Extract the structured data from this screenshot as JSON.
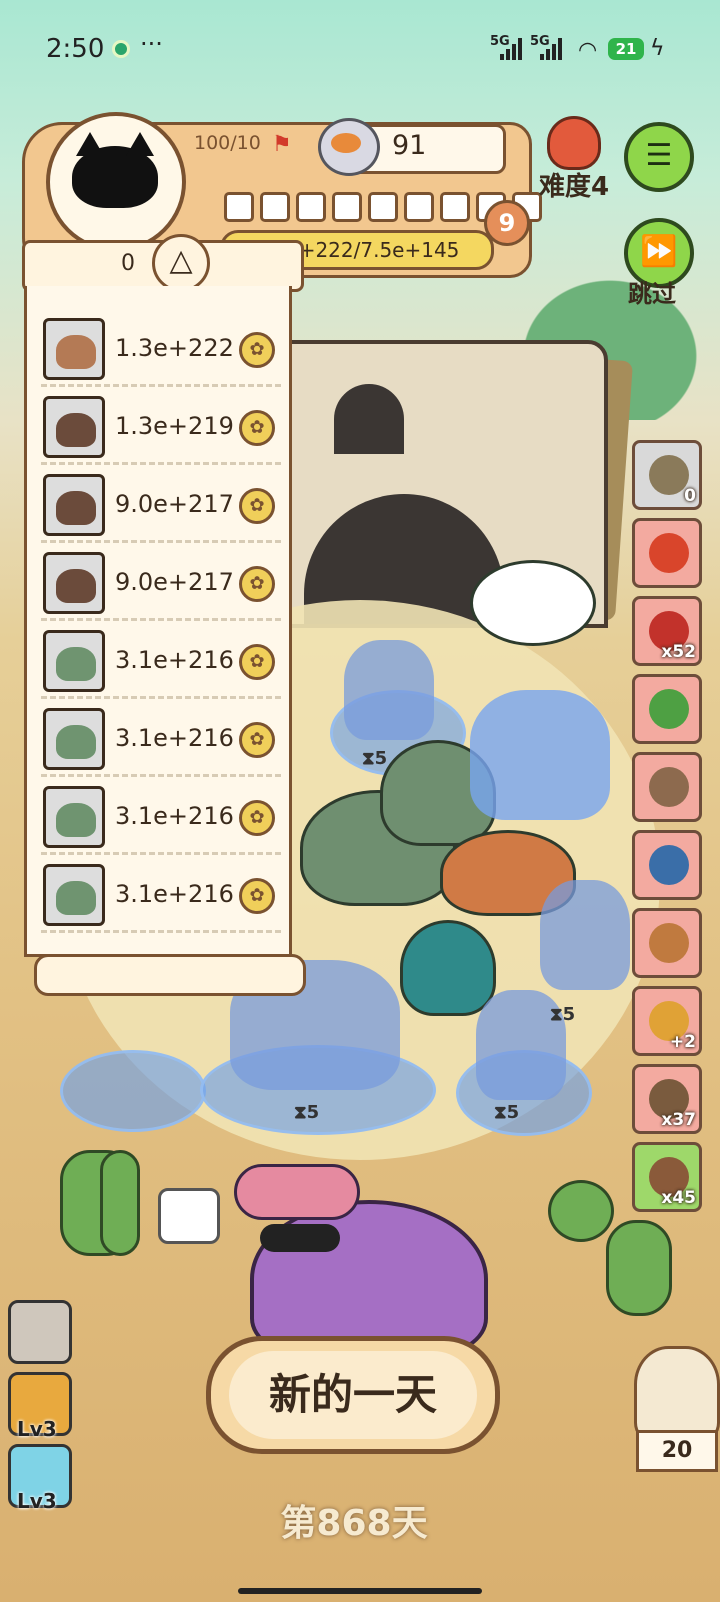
{
  "status_bar": {
    "time": "2:50",
    "more": "···",
    "net1": "5G",
    "net2": "5G",
    "battery": "21"
  },
  "player": {
    "stamina": "100/10",
    "coins": "91",
    "level": "9",
    "exp": "4.9e+222/7.5e+145",
    "level_pips": 9
  },
  "difficulty": {
    "label": "难度4"
  },
  "menu": {
    "icon": "list-icon"
  },
  "skip": {
    "label": "跳过",
    "icon": "fast-forward-icon"
  },
  "ranking": {
    "count": "0",
    "toggle_icon": "triangle-up-icon",
    "rows": [
      {
        "animal": "mammoth",
        "value": "1.3e+222",
        "color": "#b47a55"
      },
      {
        "animal": "shoebill",
        "value": "1.3e+219",
        "color": "#6b4b3b"
      },
      {
        "animal": "shoebill",
        "value": "9.0e+217",
        "color": "#6b4b3b"
      },
      {
        "animal": "shoebill",
        "value": "9.0e+217",
        "color": "#6b4b3b"
      },
      {
        "animal": "brachiosaurus",
        "value": "3.1e+216",
        "color": "#6f9470"
      },
      {
        "animal": "brachiosaurus",
        "value": "3.1e+216",
        "color": "#6f9470"
      },
      {
        "animal": "brachiosaurus",
        "value": "3.1e+216",
        "color": "#6f9470"
      },
      {
        "animal": "brachiosaurus",
        "value": "3.1e+216",
        "color": "#6f9470"
      }
    ]
  },
  "field": {
    "timers": [
      "5",
      "5",
      "5",
      "5",
      "5"
    ]
  },
  "items": [
    {
      "name": "seed-bag",
      "count": "0",
      "bg": "#d9d9d9",
      "color": "#8a7a5a"
    },
    {
      "name": "feather",
      "count": "",
      "bg": "#f3aaa0",
      "color": "#d9452b"
    },
    {
      "name": "red-sack",
      "count": "x52",
      "bg": "#f3aaa0",
      "color": "#c2322b"
    },
    {
      "name": "green-slime",
      "count": "",
      "bg": "#f3aaa0",
      "color": "#4ea043"
    },
    {
      "name": "fishbone",
      "count": "",
      "bg": "#f3aaa0",
      "color": "#8d6a4e"
    },
    {
      "name": "pagoda",
      "count": "",
      "bg": "#f3aaa0",
      "color": "#3a6ea8"
    },
    {
      "name": "gingerbread",
      "count": "",
      "bg": "#f3aaa0",
      "color": "#c07a3f"
    },
    {
      "name": "plus-two-bag",
      "count": "+2",
      "bg": "#f3aaa0",
      "color": "#e0a236"
    },
    {
      "name": "turtle-shell",
      "count": "x37",
      "bg": "#f3aaa0",
      "color": "#7a5b3e"
    },
    {
      "name": "tea-cup",
      "count": "x45",
      "bg": "#9ed86a",
      "color": "#8a5a3a"
    }
  ],
  "left_buttons": [
    {
      "name": "portal",
      "level": ""
    },
    {
      "name": "skull",
      "level": "Lv3"
    },
    {
      "name": "ghost",
      "level": "Lv3"
    }
  ],
  "new_day": {
    "label": "新的一天"
  },
  "day_counter": "第868天",
  "owl_count": "20"
}
